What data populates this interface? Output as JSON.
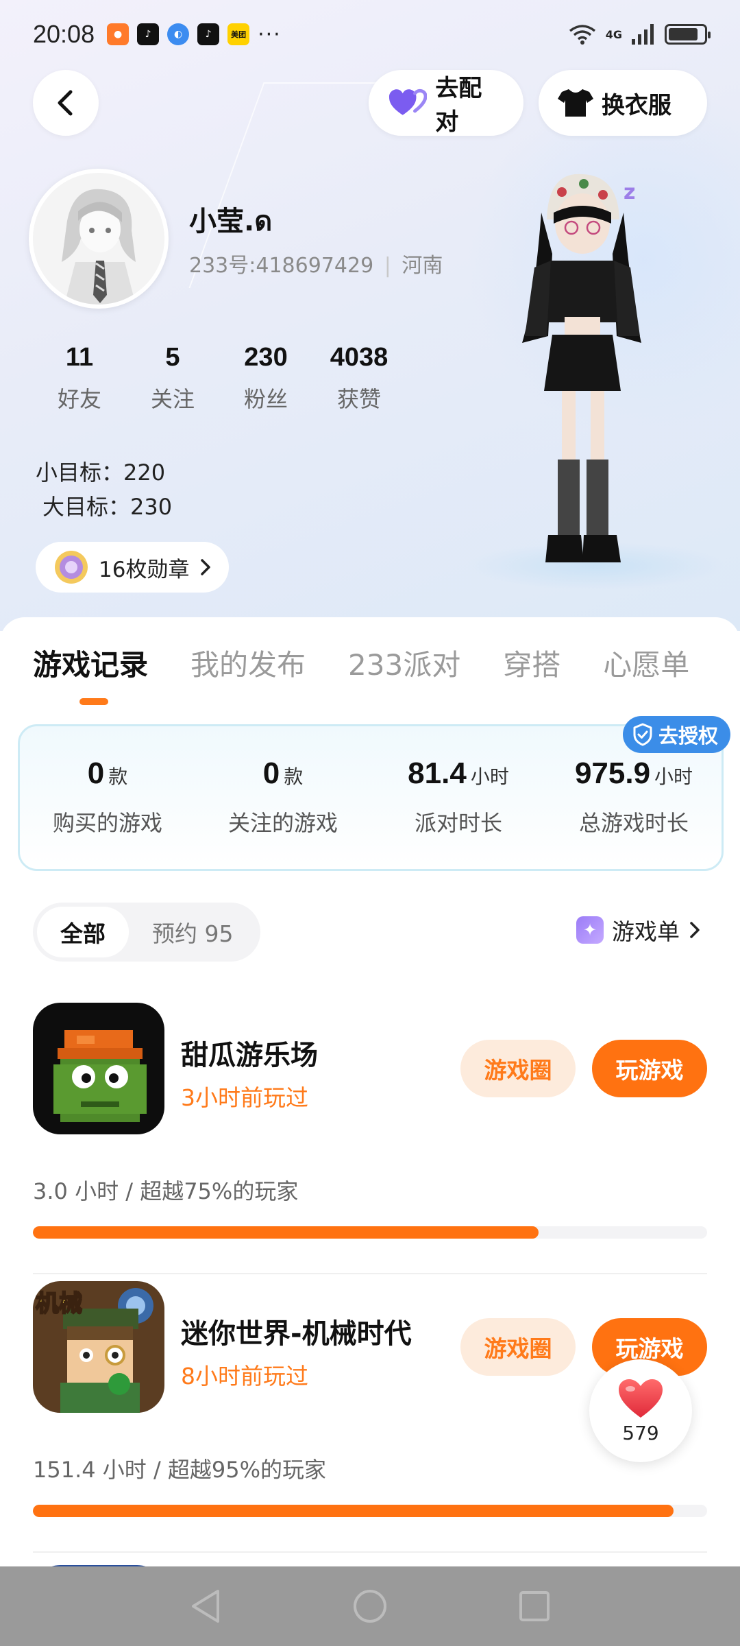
{
  "status_bar": {
    "time": "20:08",
    "apps": [
      "taobao-icon",
      "tiktok-icon",
      "browser-icon",
      "tiktok-icon",
      "meituan-icon"
    ],
    "meituan_label": "美团",
    "more": "···",
    "network": "4G",
    "battery_level": 0.85
  },
  "header": {
    "match_label": "去配对",
    "dress_label": "换衣服"
  },
  "profile": {
    "username": "小莹.ด",
    "uid_line": "233号:418697429",
    "region": "河南",
    "stats": [
      {
        "value": "11",
        "label": "好友"
      },
      {
        "value": "5",
        "label": "关注"
      },
      {
        "value": "230",
        "label": "粉丝"
      },
      {
        "value": "4038",
        "label": "获赞"
      }
    ],
    "goal_small": "小目标：220",
    "goal_big": "大目标：230",
    "badges": "16枚勋章"
  },
  "tabs": [
    "游戏记录",
    "我的发布",
    "233派对",
    "穿搭",
    "心愿单"
  ],
  "summary": {
    "items": [
      {
        "value": "0",
        "unit": "款",
        "label": "购买的游戏"
      },
      {
        "value": "0",
        "unit": "款",
        "label": "关注的游戏"
      },
      {
        "value": "81.4",
        "unit": "小时",
        "label": "派对时长"
      },
      {
        "value": "975.9",
        "unit": "小时",
        "label": "总游戏时长"
      }
    ],
    "auth_label": "去授权"
  },
  "filter": {
    "all": "全部",
    "reserved": "预约 95",
    "gamelist": "游戏单"
  },
  "games": [
    {
      "name": "甜瓜游乐场",
      "played": "3小时前玩过",
      "circle_label": "游戏圈",
      "play_label": "玩游戏",
      "meta": "3.0 小时 / 超越75%的玩家",
      "progress": 0.75
    },
    {
      "name": "迷你世界-机械时代",
      "played": "8小时前玩过",
      "circle_label": "游戏圈",
      "play_label": "玩游戏",
      "meta": "151.4 小时 / 超越95%的玩家",
      "progress": 0.95,
      "icon_text": "机械"
    }
  ],
  "like": {
    "count": "579"
  },
  "colors": {
    "accent": "#ff7211",
    "accent_light": "#fdebdc",
    "auth_blue": "#3b8de8",
    "match_heart": "#7b5cf0"
  }
}
